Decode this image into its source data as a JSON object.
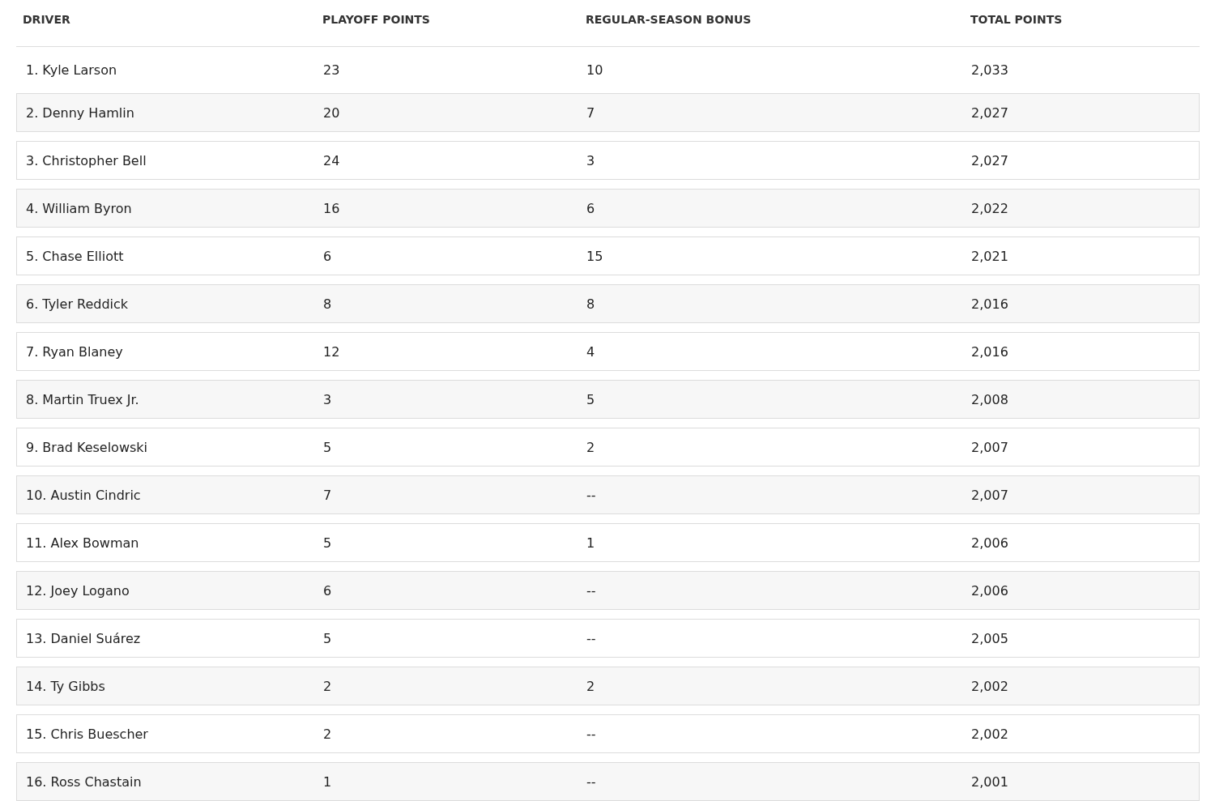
{
  "table": {
    "columns": [
      "DRIVER",
      "PLAYOFF POINTS",
      "REGULAR-SEASON BONUS",
      "TOTAL POINTS"
    ],
    "rows": [
      [
        "1. Kyle Larson",
        "23",
        "10",
        "2,033"
      ],
      [
        "2. Denny Hamlin",
        "20",
        "7",
        "2,027"
      ],
      [
        "3. Christopher Bell",
        "24",
        "3",
        "2,027"
      ],
      [
        "4. William Byron",
        "16",
        "6",
        "2,022"
      ],
      [
        "5. Chase Elliott",
        "6",
        "15",
        "2,021"
      ],
      [
        "6. Tyler Reddick",
        "8",
        "8",
        "2,016"
      ],
      [
        "7. Ryan Blaney",
        "12",
        "4",
        "2,016"
      ],
      [
        "8. Martin Truex Jr.",
        "3",
        "5",
        "2,008"
      ],
      [
        "9. Brad Keselowski",
        "5",
        "2",
        "2,007"
      ],
      [
        "10. Austin Cindric",
        "7",
        "--",
        "2,007"
      ],
      [
        "11. Alex Bowman",
        "5",
        "1",
        "2,006"
      ],
      [
        "12. Joey Logano",
        "6",
        "--",
        "2,006"
      ],
      [
        "13. Daniel Suárez",
        "5",
        "--",
        "2,005"
      ],
      [
        "14. Ty Gibbs",
        "2",
        "2",
        "2,002"
      ],
      [
        "15. Chris Buescher",
        "2",
        "--",
        "2,002"
      ],
      [
        "16. Ross Chastain",
        "1",
        "--",
        "2,001"
      ]
    ]
  }
}
